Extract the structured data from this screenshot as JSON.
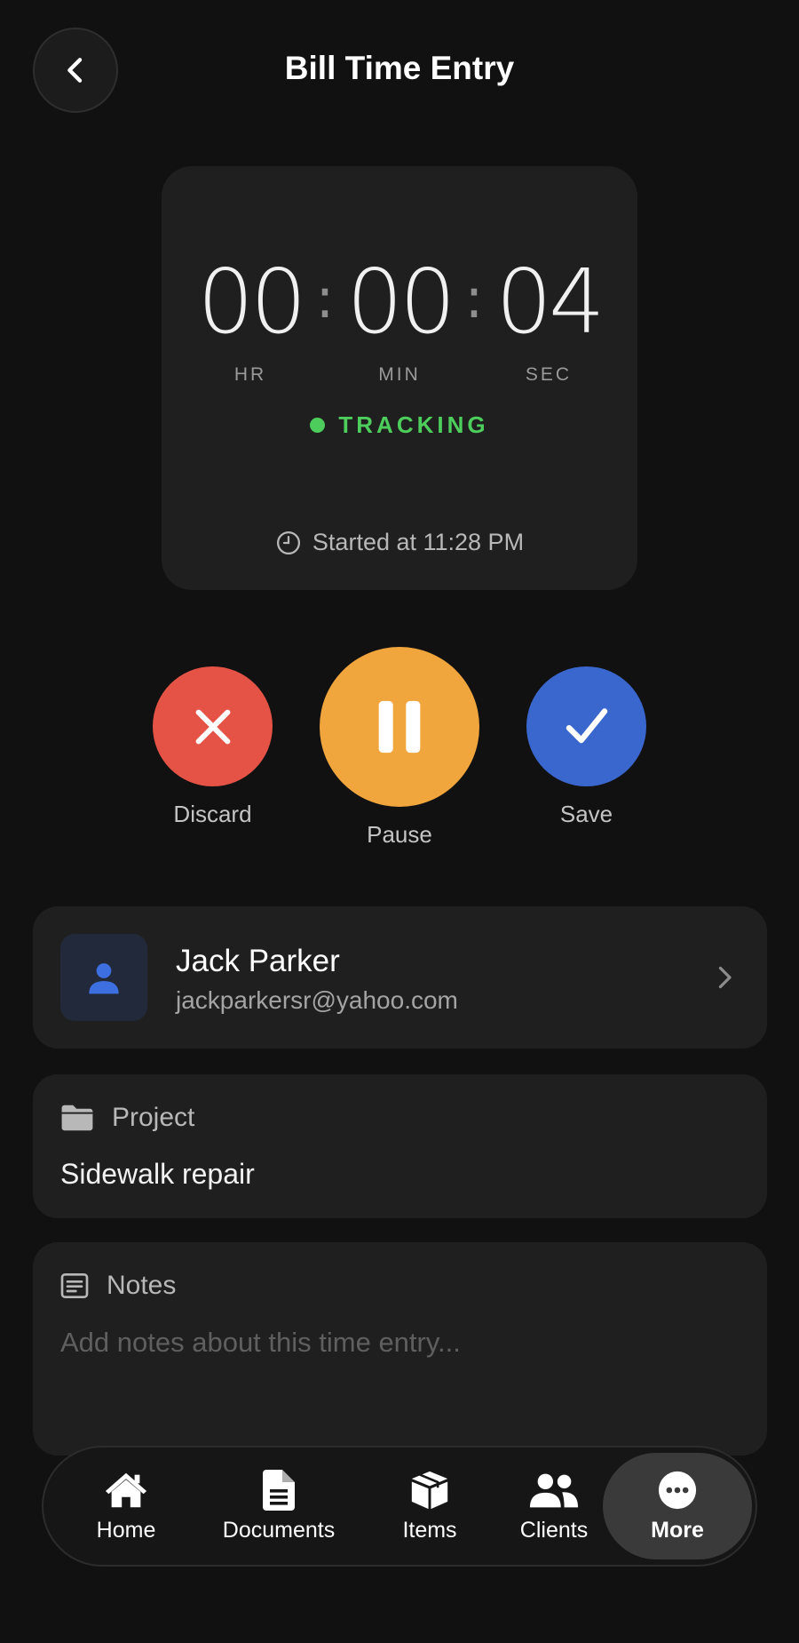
{
  "header": {
    "title": "Bill Time Entry",
    "back_icon": "chevron-left-icon"
  },
  "timer": {
    "hours": "00",
    "minutes": "00",
    "seconds": "04",
    "separator": ":",
    "hours_label": "HR",
    "minutes_label": "MIN",
    "seconds_label": "SEC",
    "status": "TRACKING",
    "status_color": "#4ccd5c",
    "started_text": "Started at 11:28 PM",
    "started_icon": "clock-icon"
  },
  "actions": {
    "discard": {
      "label": "Discard",
      "icon": "x-icon",
      "color": "#e55346"
    },
    "pause": {
      "label": "Pause",
      "icon": "pause-icon",
      "color": "#f0a53d"
    },
    "save": {
      "label": "Save",
      "icon": "check-icon",
      "color": "#3a67ce"
    }
  },
  "client": {
    "name": "Jack Parker",
    "email": "jackparkersr@yahoo.com",
    "avatar_icon": "person-icon",
    "chevron_icon": "chevron-right-icon"
  },
  "project": {
    "label": "Project",
    "icon": "folder-icon",
    "value": "Sidewalk repair"
  },
  "notes": {
    "label": "Notes",
    "icon": "notes-icon",
    "value": "",
    "placeholder": "Add notes about this time entry..."
  },
  "nav": {
    "items": [
      {
        "label": "Home",
        "icon": "home-icon"
      },
      {
        "label": "Documents",
        "icon": "document-icon"
      },
      {
        "label": "Items",
        "icon": "box-icon"
      },
      {
        "label": "Clients",
        "icon": "users-icon"
      },
      {
        "label": "More",
        "icon": "more-icon",
        "active": true
      }
    ]
  }
}
